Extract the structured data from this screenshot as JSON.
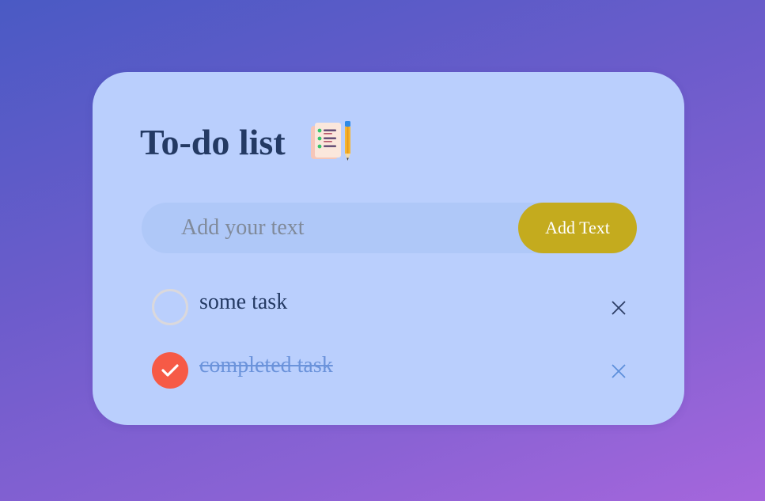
{
  "app": {
    "title": "To-do list",
    "title_icon": "notebook-pencil-icon"
  },
  "input": {
    "placeholder": "Add your text",
    "value": ""
  },
  "add_button": {
    "label": "Add Text"
  },
  "tasks": [
    {
      "text": "some task",
      "completed": false
    },
    {
      "text": "completed task",
      "completed": true
    }
  ],
  "colors": {
    "card": "#bacffd",
    "title": "#243a63",
    "accent_button": "#c4ab1e",
    "checked": "#f65a46",
    "completed_text": "#6b93db"
  }
}
